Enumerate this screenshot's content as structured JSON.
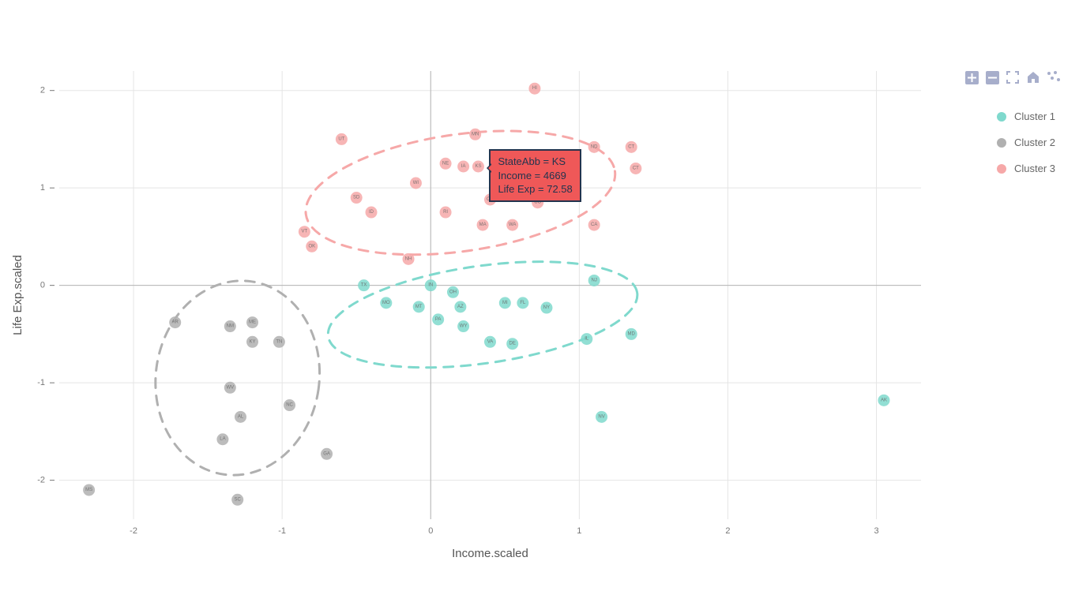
{
  "toolbar": {
    "zoom_in": "zoom in",
    "zoom_out": "zoom out",
    "fullscreen": "fullscreen",
    "home": "reset view",
    "more": "toggle points"
  },
  "legend": {
    "items": [
      {
        "label": "Cluster 1",
        "color": "#7fd9cd"
      },
      {
        "label": "Cluster 2",
        "color": "#b0b0b0"
      },
      {
        "label": "Cluster 3",
        "color": "#f6a8a8"
      }
    ]
  },
  "tooltip": {
    "line1": "StateAbb = KS",
    "line2": "Income = 4669",
    "line3": "Life Exp = 72.58"
  },
  "chart_data": {
    "type": "scatter",
    "xlabel": "Income.scaled",
    "ylabel": "Life Exp.scaled",
    "xlim": [
      -2.5,
      3.3
    ],
    "ylim": [
      -2.4,
      2.2
    ],
    "x_ticks": [
      -2,
      -1,
      0,
      1,
      2,
      3
    ],
    "y_ticks": [
      -2,
      -1,
      0,
      1,
      2
    ],
    "clusters": {
      "1": {
        "color": "#7fd9cd",
        "ellipse": {
          "cx": 0.35,
          "cy": -0.3,
          "rx": 1.05,
          "ry": 0.5,
          "rot_deg": -8
        }
      },
      "2": {
        "color": "#b0b0b0",
        "ellipse": {
          "cx": -1.3,
          "cy": -0.95,
          "rx": 0.55,
          "ry": 1.0,
          "rot_deg": 8
        }
      },
      "3": {
        "color": "#f6a8a8",
        "ellipse": {
          "cx": 0.2,
          "cy": 0.95,
          "rx": 1.05,
          "ry": 0.6,
          "rot_deg": -8
        }
      }
    },
    "series": [
      {
        "name": "Cluster 1",
        "cluster": 1,
        "points": [
          {
            "label": "TX",
            "x": -0.45,
            "y": 0.0
          },
          {
            "label": "MO",
            "x": -0.3,
            "y": -0.18
          },
          {
            "label": "IN",
            "x": 0.0,
            "y": 0.0
          },
          {
            "label": "MT",
            "x": -0.08,
            "y": -0.22
          },
          {
            "label": "OH",
            "x": 0.15,
            "y": -0.07
          },
          {
            "label": "AZ",
            "x": 0.2,
            "y": -0.22
          },
          {
            "label": "PA",
            "x": 0.05,
            "y": -0.35
          },
          {
            "label": "WY",
            "x": 0.22,
            "y": -0.42
          },
          {
            "label": "MI",
            "x": 0.5,
            "y": -0.18
          },
          {
            "label": "FL",
            "x": 0.62,
            "y": -0.18
          },
          {
            "label": "NY",
            "x": 0.78,
            "y": -0.23
          },
          {
            "label": "VA",
            "x": 0.4,
            "y": -0.58
          },
          {
            "label": "DE",
            "x": 0.55,
            "y": -0.6
          },
          {
            "label": "IL",
            "x": 1.05,
            "y": -0.55
          },
          {
            "label": "NJ",
            "x": 1.1,
            "y": 0.05
          },
          {
            "label": "MD",
            "x": 1.35,
            "y": -0.5
          },
          {
            "label": "NV",
            "x": 1.15,
            "y": -1.35
          },
          {
            "label": "AK",
            "x": 3.05,
            "y": -1.18
          }
        ]
      },
      {
        "name": "Cluster 2",
        "cluster": 2,
        "points": [
          {
            "label": "AR",
            "x": -1.72,
            "y": -0.38
          },
          {
            "label": "NM",
            "x": -1.35,
            "y": -0.42
          },
          {
            "label": "ME",
            "x": -1.2,
            "y": -0.38
          },
          {
            "label": "KY",
            "x": -1.2,
            "y": -0.58
          },
          {
            "label": "TN",
            "x": -1.02,
            "y": -0.58
          },
          {
            "label": "WV",
            "x": -1.35,
            "y": -1.05
          },
          {
            "label": "NC",
            "x": -0.95,
            "y": -1.23
          },
          {
            "label": "AL",
            "x": -1.28,
            "y": -1.35
          },
          {
            "label": "LA",
            "x": -1.4,
            "y": -1.58
          },
          {
            "label": "GA",
            "x": -0.7,
            "y": -1.73
          },
          {
            "label": "MS",
            "x": -2.3,
            "y": -2.1
          },
          {
            "label": "SC",
            "x": -1.3,
            "y": -2.2
          }
        ]
      },
      {
        "name": "Cluster 3",
        "cluster": 3,
        "points": [
          {
            "label": "HI",
            "x": 0.7,
            "y": 2.02
          },
          {
            "label": "MN",
            "x": 0.3,
            "y": 1.55
          },
          {
            "label": "UT",
            "x": -0.6,
            "y": 1.5
          },
          {
            "label": "ND",
            "x": 1.1,
            "y": 1.42
          },
          {
            "label": "CT",
            "x": 1.35,
            "y": 1.42
          },
          {
            "label": "NE",
            "x": 0.1,
            "y": 1.25
          },
          {
            "label": "IA",
            "x": 0.22,
            "y": 1.22
          },
          {
            "label": "KS",
            "x": 0.32,
            "y": 1.22
          },
          {
            "label": "CT2",
            "x": 1.38,
            "y": 1.2
          },
          {
            "label": "WI",
            "x": -0.1,
            "y": 1.05
          },
          {
            "label": "SD",
            "x": -0.5,
            "y": 0.9
          },
          {
            "label": "OR",
            "x": 0.4,
            "y": 0.88
          },
          {
            "label": "CO",
            "x": 0.72,
            "y": 0.85
          },
          {
            "label": "RI",
            "x": 0.1,
            "y": 0.75
          },
          {
            "label": "ID",
            "x": -0.4,
            "y": 0.75
          },
          {
            "label": "MA",
            "x": 0.35,
            "y": 0.62
          },
          {
            "label": "WA",
            "x": 0.55,
            "y": 0.62
          },
          {
            "label": "CA",
            "x": 1.1,
            "y": 0.62
          },
          {
            "label": "VT",
            "x": -0.85,
            "y": 0.55
          },
          {
            "label": "OK",
            "x": -0.8,
            "y": 0.4
          },
          {
            "label": "NH",
            "x": -0.15,
            "y": 0.27
          }
        ]
      }
    ]
  }
}
